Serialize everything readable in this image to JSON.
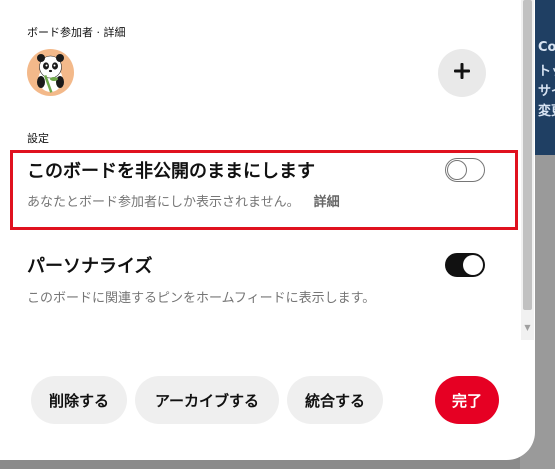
{
  "background": {
    "lines": [
      "Co",
      "トッ",
      "サイ",
      "変更"
    ]
  },
  "collaborators": {
    "heading": "ボード参加者 · 詳細",
    "avatar_icon": "panda-avatar-icon",
    "add_icon": "plus-icon"
  },
  "settings": {
    "heading": "設定",
    "secret": {
      "title": "このボードを非公開のままにします",
      "description": "あなたとボード参加者にしか表示されません。",
      "more": "詳細",
      "enabled": false
    },
    "personalize": {
      "title": "パーソナライズ",
      "description": "このボードに関連するピンをホームフィードに表示します。",
      "enabled": true
    }
  },
  "actions": {
    "delete": "削除する",
    "archive": "アーカイブする",
    "merge": "統合する",
    "done": "完了"
  },
  "colors": {
    "accent": "#e60023",
    "highlight": "#e0111f"
  }
}
